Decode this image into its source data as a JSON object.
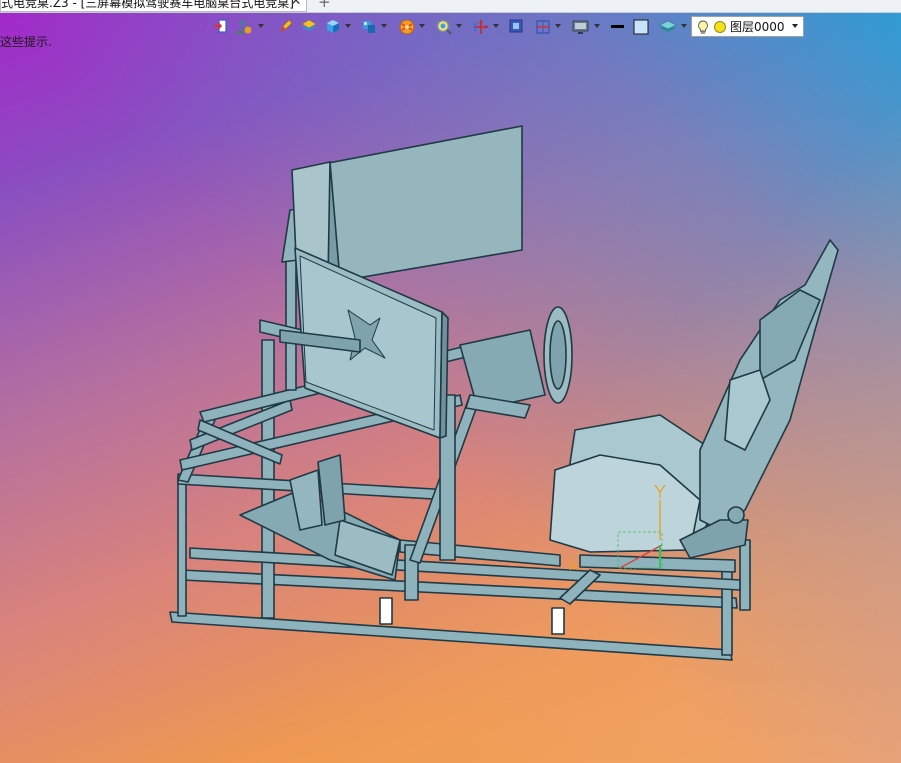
{
  "document_tab": {
    "title": "式电竞桌.Z3 - [三屏幕模拟驾驶赛车电脑桌台式电竞桌]",
    "close_glyph": "✕",
    "add_glyph": "+"
  },
  "toolbar": {
    "buttons": [
      {
        "icon": "exit-icon",
        "has_menu": false
      },
      {
        "icon": "snap-filter-icon",
        "has_menu": true
      },
      {
        "icon": "pencil-icon",
        "has_menu": false
      },
      {
        "icon": "stack-icon",
        "has_menu": false
      },
      {
        "icon": "cube-view-icon",
        "has_menu": true
      },
      {
        "icon": "view-orient-icon",
        "has_menu": true
      },
      {
        "icon": "render-sphere-icon",
        "has_menu": true
      },
      {
        "icon": "zoom-icon",
        "has_menu": true
      },
      {
        "icon": "pan-rotate-icon",
        "has_menu": true
      },
      {
        "icon": "frame-icon",
        "has_menu": false
      },
      {
        "icon": "section-icon",
        "has_menu": true
      },
      {
        "icon": "display-icon",
        "has_menu": true
      },
      {
        "icon": "line-color-icon",
        "has_menu": false
      },
      {
        "icon": "fill-color-icon",
        "has_menu": false
      },
      {
        "icon": "layer-stack-icon",
        "has_menu": true
      }
    ],
    "line_color": "#000000",
    "fill_color": "#c8e4f8"
  },
  "layer_selector": {
    "value": "图层0000",
    "dot_color": "#f3e01a"
  },
  "hint_text": "这些提示.",
  "viewport": {
    "background_colors": [
      "#a526c9",
      "#2fa3d6",
      "#f7a832",
      "#e8a08a"
    ],
    "model_color": "#8fb3bd"
  }
}
